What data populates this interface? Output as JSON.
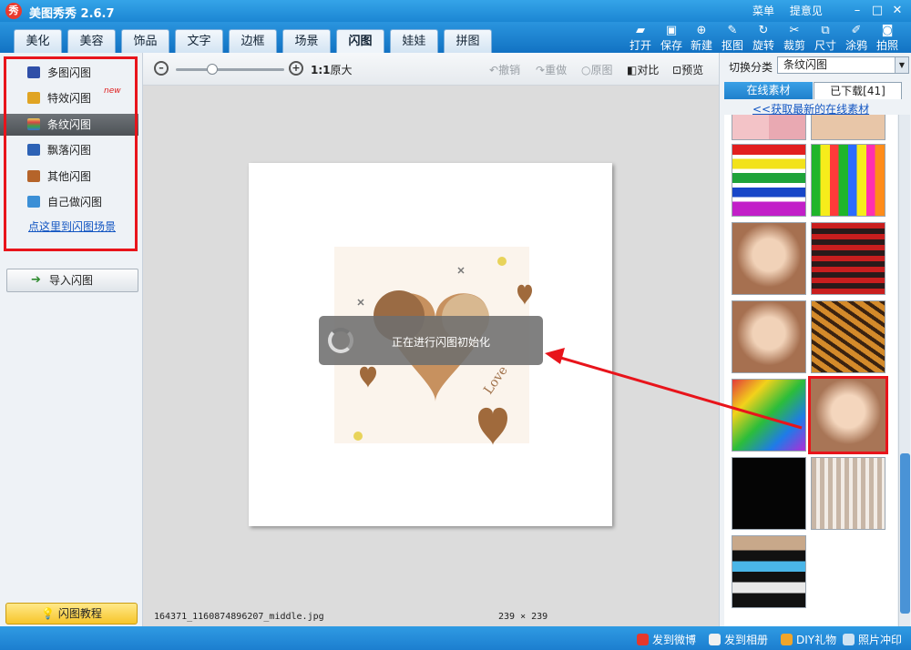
{
  "app": {
    "logo_char": "秀",
    "title": "美图秀秀 2.6.7",
    "menu_label": "菜单",
    "feedback_label": "提意见"
  },
  "main_tabs": [
    "美化",
    "美容",
    "饰品",
    "文字",
    "边框",
    "场景",
    "闪图",
    "娃娃",
    "拼图"
  ],
  "active_tab": "闪图",
  "tools": [
    {
      "label": "打开",
      "icon": "folder-icon"
    },
    {
      "label": "保存",
      "icon": "disk-icon"
    },
    {
      "label": "新建",
      "icon": "plus-icon"
    },
    {
      "label": "抠图",
      "icon": "pen-icon"
    },
    {
      "label": "旋转",
      "icon": "rotate-icon"
    },
    {
      "label": "裁剪",
      "icon": "scissors-icon"
    },
    {
      "label": "尺寸",
      "icon": "resize-icon"
    },
    {
      "label": "涂鸦",
      "icon": "brush-icon"
    },
    {
      "label": "拍照",
      "icon": "camera-icon"
    }
  ],
  "left_menu": {
    "items": [
      {
        "label": "多图闪图",
        "color": "#2f4fa8"
      },
      {
        "label": "特效闪图",
        "color": "#e0a423",
        "badge": "new"
      },
      {
        "label": "条纹闪图",
        "color": "#e8d15a",
        "selected": true
      },
      {
        "label": "飘落闪图",
        "color": "#2d62b5"
      },
      {
        "label": "其他闪图",
        "color": "#b5642a"
      },
      {
        "label": "自己做闪图",
        "color": "#3b8fd6"
      }
    ],
    "scene_link": "点这里到闪图场景",
    "import_label": "导入闪图",
    "tutorial_label": "闪图教程"
  },
  "canvas_toolbar": {
    "ratio": "1:1",
    "original_size": "原大",
    "undo": "撤销",
    "redo": "重做",
    "original": "原图",
    "compare": "对比",
    "preview": "预览",
    "zoom_fraction": 0.34
  },
  "loading_text": "正在进行闪图初始化",
  "file_name": "164371_1160874896207_middle.jpg",
  "image_size": "239 × 239",
  "right_panel": {
    "category_label": "切换分类",
    "category_value": "条纹闪图",
    "tab_online": "在线素材",
    "tab_downloaded": "已下载[41]",
    "online_link": "<<获取最新的在线素材"
  },
  "status_bar": {
    "weibo": "发到微博",
    "album": "发到相册",
    "gift": "DIY礼物",
    "print": "照片冲印"
  },
  "colors": {
    "accent": "#1b86d3",
    "highlight": "#e8141b"
  }
}
